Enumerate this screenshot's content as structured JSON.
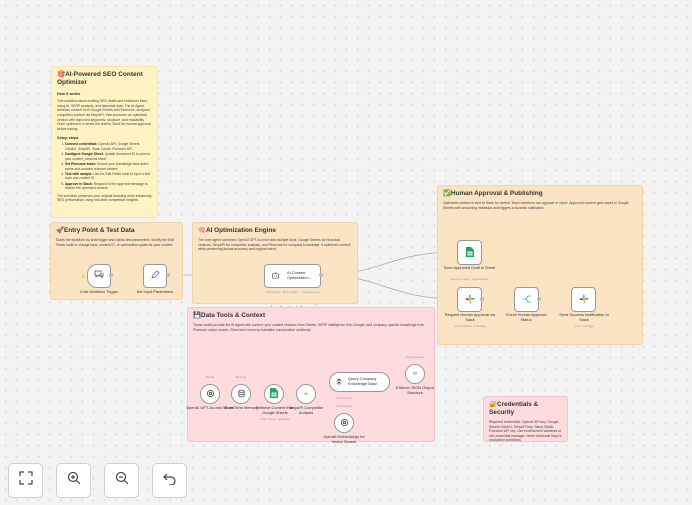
{
  "notes": {
    "seo": {
      "title": "🎯AI-Powered SEO Content Optimizer",
      "how_title": "How it works",
      "how_body": "This workflow takes existing SEO drafts and enhances them using AI, SERP analysis, and historical data. The AI Agent retrieves context from Google Sheets and Pinecone, analyzes competitor content via SerpAPI, then produces an optimized version with improved keywords, structure, and readability. Once optimized, it sends the draft to Slack for human approval before saving.",
      "setup_title": "Setup steps",
      "steps": [
        {
          "bold": "Connect credentials:",
          "text": " OpenAI API, Google Sheets OAuth2, SerpAPI, Slack OAuth, Pinecone API"
        },
        {
          "bold": "Configure Google Sheet:",
          "text": " Update document ID to point to your content_versions sheet"
        },
        {
          "bold": "Set Pinecone index:",
          "text": " Ensure your knowledge base index exists and contains relevant content"
        },
        {
          "bold": "Test with sample:",
          "text": " Use the Edit Fields node to input a test topic and content ID"
        },
        {
          "bold": "Approve in Slack:",
          "text": " Respond to the approval message to finalize the optimized content"
        }
      ],
      "footer": "The workflow preserves your original meaning while enhancing SEO performance using real-time competitive insights."
    },
    "entry": {
      "title": "🚀Entry Point & Test Data",
      "body": "Starts the workflow via chat trigger and injects test parameters. Modify the Edit Fields node to change topic, content ID, or optimization goals for your content."
    },
    "ai": {
      "title": "🧠AI Optimization Engine",
      "body": "The core agent combines OpenAI GPT-4o-mini with multiple tools: Google Sheets for historical versions, SerpAPI for competitor analysis, and Pinecone for company knowledge. It optimizes content while preserving factual accuracy and original intent."
    },
    "tools": {
      "title": "💾Data Tools & Context",
      "body": "These nodes provide the AI Agent with context: your content versions from Sheets, SERP intelligence from Google, and company-specific knowledge from Pinecone vector search. Short-term memory maintains conversation continuity."
    },
    "approval": {
      "title": "✅Human Approval & Publishing",
      "body": "Optimized content is sent to Slack for review. Team members can approve or reject. Approved content gets saved to Google Sheets with versioning metadata and triggers a success notification."
    },
    "creds": {
      "title": "🔐Credentials & Security",
      "body": "Required credentials: OpenAI API key, Google Sheets OAuth2, SerpAPI key, Slack OAuth, Pinecone API key. Use environment variables or n8n credential manager. Never hardcode keys in production workflows."
    }
  },
  "nodes": {
    "chat_trigger": "Chat Workflow Trigger",
    "set_params": "Set Input Parameters",
    "agent": "AI Content Optimization...",
    "agent_tags": {
      "model": "Chat Model",
      "memory": "Memory",
      "tool": "Tool",
      "parser": "Output Parser"
    },
    "openai_model": "OpenAI GPT-4o-mini Model",
    "memory": "Short-Term Memory",
    "sheets_tool": "Retrieve Content from Google Sheets",
    "sheets_tool_sub": "read: sheet · getRows",
    "serpapi": "SerpAPI Competitor Analysis",
    "knowledge": "Query Company Knowledge Base",
    "embeddings": "OpenAI Embeddings for Vector Search",
    "json_parser": "Enforce JSON Output Structure",
    "small": {
      "model": "Model",
      "memory": "Memory",
      "embedding": "Embedding",
      "parser_out": "Output Parser"
    },
    "save_draft": "Save Approved Draft to Sheet",
    "save_draft_sub": "append: sheet · appendRow",
    "request_approval": "Request Human Approval via Slack",
    "request_approval_sub": "sendAndWait: message",
    "check_approval": "Check Human Approval Status",
    "send_success": "Send Success Notification to Slack",
    "send_success_sub": "post: message"
  },
  "toolbar": {
    "fit": "fit-view",
    "zoom_in": "zoom-in",
    "zoom_out": "zoom-out",
    "undo": "undo"
  },
  "colors": {
    "note_yellow": "#fff3c4",
    "note_orange": "#fbe4c4",
    "note_red": "#fddbdf",
    "sheets_green": "#23a566",
    "trigger_red": "#ff6d5a"
  }
}
